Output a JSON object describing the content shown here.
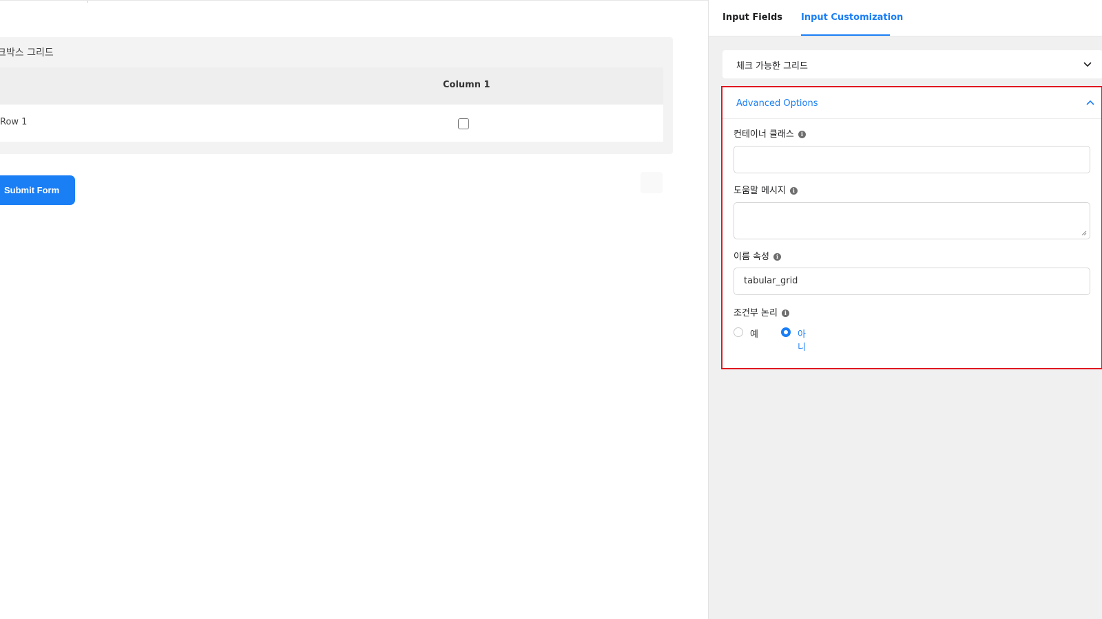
{
  "canvas": {
    "grid_title": "크박스 그리드",
    "column_header": "Column 1",
    "row_label": "Row 1",
    "submit_label": "Submit Form"
  },
  "panel": {
    "tabs": [
      {
        "label": "Input Fields",
        "active": false
      },
      {
        "label": "Input Customization",
        "active": true
      }
    ],
    "field_type": "체크 가능한 그리드",
    "advanced": {
      "title": "Advanced Options",
      "container_class_label": "컨테이너 클래스",
      "container_class_value": "",
      "help_message_label": "도움말 메시지",
      "help_message_value": "",
      "name_attr_label": "이름 속성",
      "name_attr_value": "tabular_grid",
      "conditional_label": "조건부 논리",
      "conditional_options": [
        {
          "label": "예",
          "selected": false
        },
        {
          "label": "아니",
          "selected": true
        }
      ]
    }
  },
  "colors": {
    "accent": "#1a7ef5",
    "highlight_border": "#e0161f",
    "panel_bg": "#f0f0f0"
  },
  "icons": [
    "chevron-down-icon",
    "chevron-up-icon",
    "info-icon"
  ]
}
